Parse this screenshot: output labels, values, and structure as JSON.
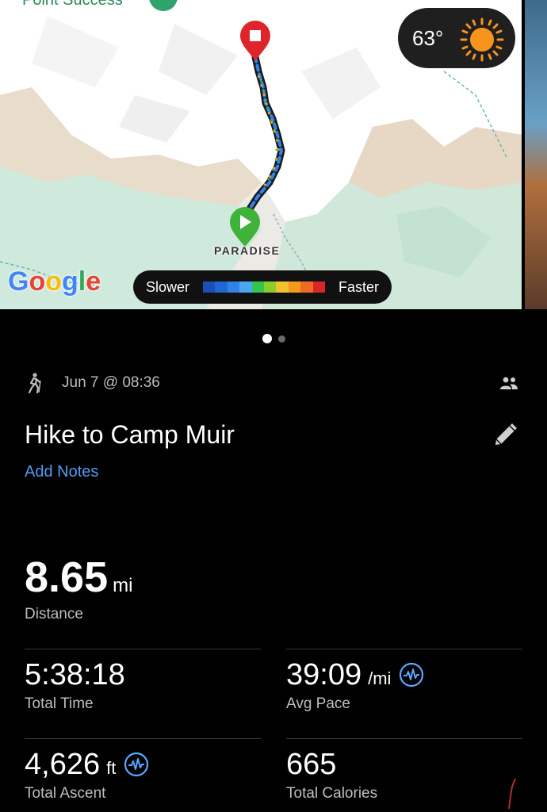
{
  "map": {
    "top_label": "Point Success",
    "start_label": "PARADISE",
    "google_logo": {
      "G": "G",
      "o1": "o",
      "o2": "o",
      "g": "g",
      "l": "l",
      "e": "e"
    },
    "weather": {
      "temperature": "63°",
      "icon": "sun-icon"
    },
    "speed_legend": {
      "slower": "Slower",
      "faster": "Faster",
      "colors": [
        "#1a4fb5",
        "#2166d1",
        "#2f83e8",
        "#4aa7f0",
        "#35c44f",
        "#8ccc2a",
        "#f2c12e",
        "#f39a1f",
        "#ef6a22",
        "#d9262a"
      ]
    }
  },
  "pager": {
    "active": 1,
    "count": 2
  },
  "activity": {
    "type_icon": "hiking-icon",
    "date": "Jun 7 @ 08:36",
    "title": "Hike to Camp Muir",
    "add_notes": "Add Notes"
  },
  "stats": {
    "distance": {
      "value": "8.65",
      "unit": "mi",
      "label": "Distance"
    },
    "total_time": {
      "value": "5:38:18",
      "label": "Total Time"
    },
    "avg_pace": {
      "value": "39:09",
      "unit": "/mi",
      "label": "Avg Pace"
    },
    "total_ascent": {
      "value": "4,626",
      "unit": "ft",
      "label": "Total Ascent"
    },
    "total_calories": {
      "value": "665",
      "label": "Total Calories"
    }
  },
  "colors": {
    "accent_link": "#4f9df5",
    "pulse_icon": "#5aa8ff",
    "start_pin": "#3fb23a",
    "end_pin": "#e0242c"
  }
}
